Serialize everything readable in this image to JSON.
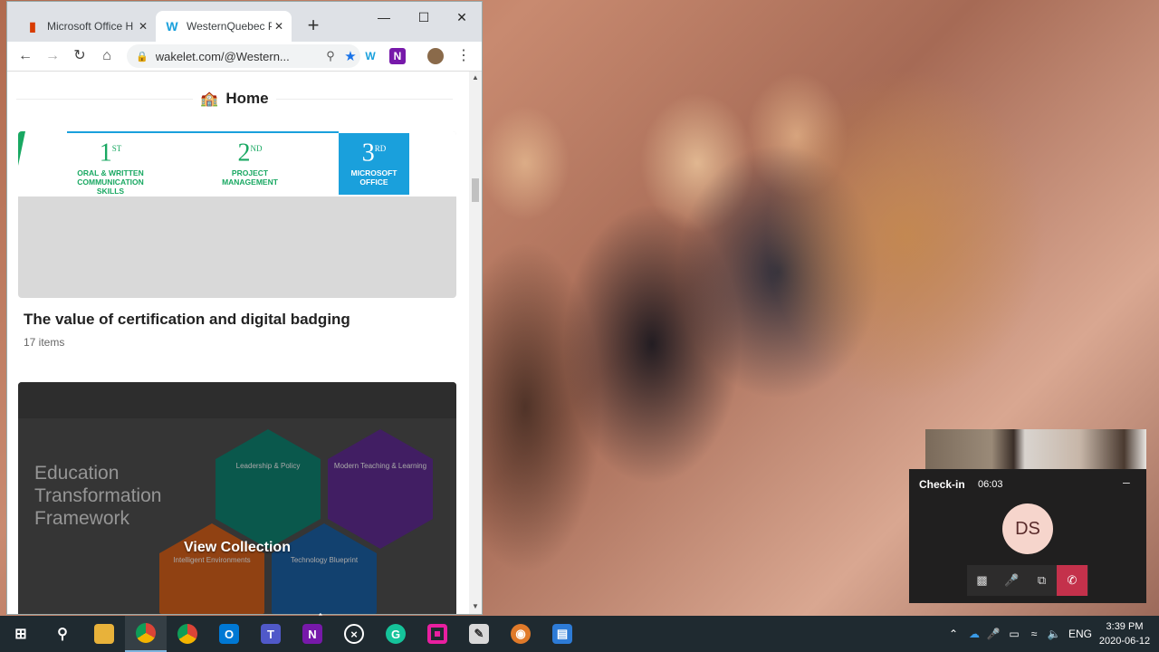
{
  "browser": {
    "tabs": [
      {
        "title": "Microsoft Office H",
        "icon": "office-icon"
      },
      {
        "title": "WesternQuebec P",
        "icon": "wakelet-icon"
      }
    ],
    "new_tab": "+",
    "url": "wakelet.com/@Western...",
    "extensions": {
      "wakelet": "W",
      "onenote": "N"
    }
  },
  "page": {
    "header": "Home",
    "collections": [
      {
        "title": "The value of certification and digital badging",
        "count": "17 items",
        "badges": [
          {
            "num": "1",
            "sup": "ST",
            "label": "ORAL & WRITTEN COMMUNICATION SKILLS"
          },
          {
            "num": "2",
            "sup": "ND",
            "label": "PROJECT MANAGEMENT"
          },
          {
            "num": "3",
            "sup": "RD",
            "label": "MICROSOFT OFFICE"
          }
        ]
      },
      {
        "cover_title": "Education Transformation Framework",
        "hexes": [
          "Leadership & Policy",
          "Modern Teaching & Learning",
          "Intelligent Environments",
          "Technology Blueprint"
        ],
        "action": "View Collection"
      }
    ]
  },
  "teams": {
    "title": "Check-in",
    "timer": "06:03",
    "initials": "DS"
  },
  "taskbar": {
    "language": "ENG",
    "time": "3:39 PM",
    "date": "2020-06-12"
  },
  "colors": {
    "accent_green": "#19a862",
    "accent_blue": "#1aa0dc",
    "hangup_red": "#c4314b"
  }
}
